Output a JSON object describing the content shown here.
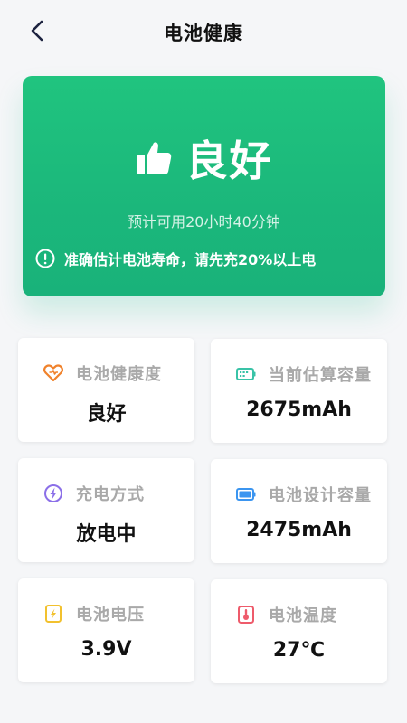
{
  "header": {
    "title": "电池健康"
  },
  "hero": {
    "status": "良好",
    "estimate": "预计可用20小时40分钟",
    "notice": "准确估计电池寿命，请先充20%以上电"
  },
  "cards": [
    {
      "label": "电池健康度",
      "value": "良好",
      "icon": "heart-icon",
      "color": "#f0822c"
    },
    {
      "label": "当前估算容量",
      "value": "2675mAh",
      "icon": "battery-estimate-icon",
      "color": "#39c3a7"
    },
    {
      "label": "充电方式",
      "value": "放电中",
      "icon": "charge-mode-icon",
      "color": "#8b6fe8"
    },
    {
      "label": "电池设计容量",
      "value": "2475mAh",
      "icon": "battery-design-icon",
      "color": "#3b95f0"
    },
    {
      "label": "电池电压",
      "value": "3.9V",
      "icon": "voltage-icon",
      "color": "#f2c12e"
    },
    {
      "label": "电池温度",
      "value": "27℃",
      "icon": "thermometer-icon",
      "color": "#ee5b6b"
    }
  ],
  "colors": {
    "hero_green": "#1bb77b",
    "background": "#f5f6f8"
  }
}
